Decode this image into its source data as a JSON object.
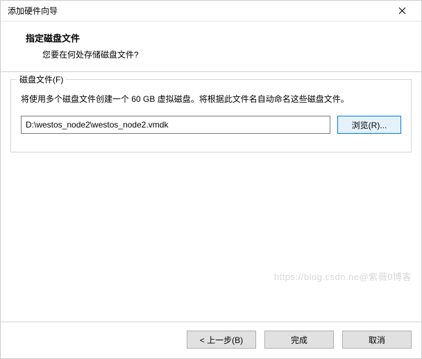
{
  "window": {
    "title": "添加硬件向导"
  },
  "header": {
    "sub_title": "指定磁盘文件",
    "question": "您要在何处存储磁盘文件?"
  },
  "group": {
    "legend": "磁盘文件(F)",
    "description": "将使用多个磁盘文件创建一个 60 GB 虚拟磁盘。将根据此文件名自动命名这些磁盘文件。",
    "path_value": "D:\\westos_node2\\westos_node2.vmdk",
    "browse_label": "浏览(R)..."
  },
  "footer": {
    "back_label": "< 上一步(B)",
    "finish_label": "完成",
    "cancel_label": "取消"
  },
  "watermark": "https://blog.csdn.ne@紫薇0博客"
}
